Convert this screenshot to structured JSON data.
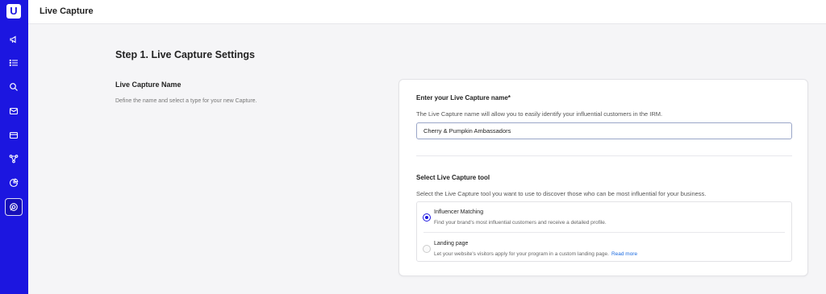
{
  "sidebar": {
    "logo_text": "U",
    "items": [
      {
        "icon": "megaphone-icon"
      },
      {
        "icon": "list-icon"
      },
      {
        "icon": "search-icon"
      },
      {
        "icon": "mail-icon"
      },
      {
        "icon": "credit-card-icon"
      },
      {
        "icon": "workflow-icon"
      },
      {
        "icon": "pie-chart-icon"
      },
      {
        "icon": "live-capture-icon",
        "active": true
      }
    ]
  },
  "header": {
    "title": "Live Capture"
  },
  "step": {
    "title": "Step 1. Live Capture Settings"
  },
  "section": {
    "label": "Live Capture Name",
    "description": "Define the name and select a type for your new Capture."
  },
  "form": {
    "name_label": "Enter your Live Capture name*",
    "name_help": "The Live Capture name will allow you to easily identify your influential customers in the IRM.",
    "name_value": "Cherry & Pumpkin Ambassadors",
    "tool_label": "Select Live Capture tool",
    "tool_help": "Select the Live Capture tool you want to use to discover those who can be most influential for your business.",
    "options": [
      {
        "title": "Influencer Matching",
        "description": "Find your brand's most influential customers and receive a detailed profile.",
        "selected": true
      },
      {
        "title": "Landing page",
        "description": "Let your website's visitors apply for your program in a custom landing page.",
        "link": "Read more",
        "selected": false
      }
    ]
  },
  "colors": {
    "accent": "#1c16e0",
    "link": "#1c6be0"
  }
}
